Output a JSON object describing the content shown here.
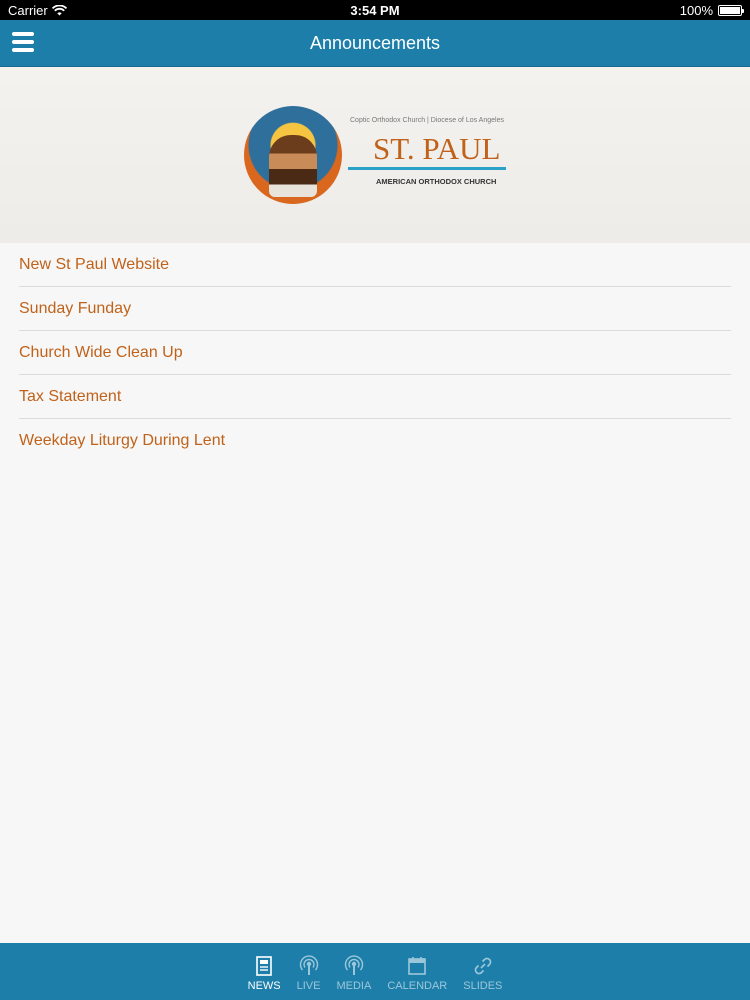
{
  "status_bar": {
    "carrier": "Carrier",
    "time": "3:54 PM",
    "battery": "100%",
    "battery_level": 1.0
  },
  "nav": {
    "title": "Announcements"
  },
  "banner": {
    "top_text": "Coptic Orthodox Church | Diocese of Los Angeles",
    "title": "ST. PAUL",
    "bottom_text": "AMERICAN ORTHODOX CHURCH"
  },
  "announcements": [
    "New St Paul Website",
    "Sunday Funday",
    "Church Wide Clean Up",
    "Tax Statement",
    "Weekday Liturgy During Lent"
  ],
  "tabs": [
    {
      "label": "NEWS",
      "icon": "news-icon",
      "active": true
    },
    {
      "label": "LIVE",
      "icon": "podcast-icon",
      "active": false
    },
    {
      "label": "MEDIA",
      "icon": "podcast-icon",
      "active": false
    },
    {
      "label": "CALENDAR",
      "icon": "calendar-icon",
      "active": false
    },
    {
      "label": "SLIDES",
      "icon": "link-icon",
      "active": false
    }
  ],
  "colors": {
    "primary": "#1d7fa9",
    "accent": "#c0621a"
  }
}
